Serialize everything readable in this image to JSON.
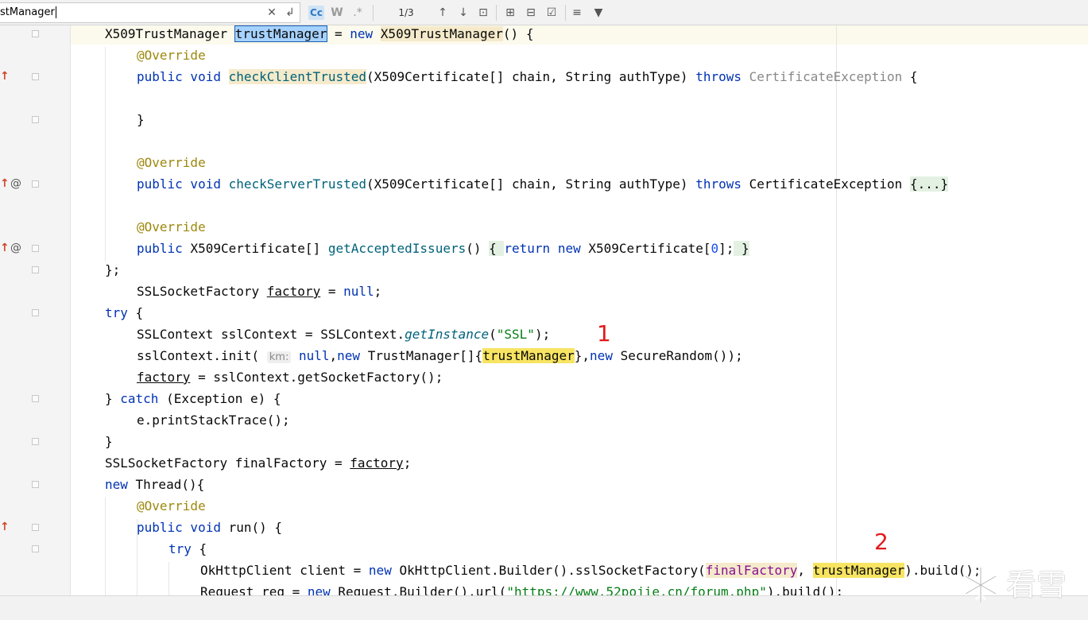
{
  "find_bar": {
    "search_value": "stManager",
    "match_case_label": "Cc",
    "words_label": "W",
    "regex_label": ".*",
    "match_count": "1/3",
    "icons": [
      "clear-icon",
      "history-icon",
      "prev-occurrence-icon",
      "next-occurrence-icon",
      "select-all-icon",
      "add-selection-icon",
      "remove-selection-icon",
      "toggle-selection-icon",
      "multiline-icon",
      "filter-icon"
    ]
  },
  "code": {
    "l1": {
      "type": "X509TrustManager ",
      "var": "trustManager",
      "eq": " = ",
      "new": "new ",
      "cls": "X509TrustManager",
      "rest": "() {"
    },
    "l2": {
      "ann": "@Override"
    },
    "l3": {
      "kw": "public void ",
      "mth": "checkClientTrusted",
      "args": "(X509Certificate[] chain, String authType) ",
      "throws": "throws ",
      "exc": "CertificateException",
      "tail": " {"
    },
    "l5": {
      "brace": "}"
    },
    "l7": {
      "ann": "@Override"
    },
    "l8": {
      "kw": "public void ",
      "mth": "checkServerTrusted",
      "args": "(X509Certificate[] chain, String authType) ",
      "throws": "throws ",
      "exc": "CertificateException ",
      "fold": "{...}"
    },
    "l10": {
      "ann": "@Override"
    },
    "l11": {
      "kw": "public ",
      "type": "X509Certificate[] ",
      "mth": "getAcceptedIssuers",
      "paren": "() ",
      "fold1": "{ ",
      "ret": "return ",
      "new": "new ",
      "cls": "X509Certificate[",
      "num": "0",
      "close": "];",
      "fold2": " }"
    },
    "l12": {
      "text": "};"
    },
    "l13": {
      "type": "SSLSocketFactory ",
      "var": "factory",
      "eq": " = ",
      "null": "null",
      ";": ";"
    },
    "l14": {
      "kw": "try",
      "rest": " {"
    },
    "l15": {
      "a": "SSLContext sslContext = SSLContext.",
      "m": "getInstance",
      "b": "(",
      "s": "\"SSL\"",
      "c": ");"
    },
    "l16": {
      "a": "sslContext.init( ",
      "hint": "km:",
      "null": " null",
      ",": ",",
      "new": "new ",
      "b": "TrustManager[]{",
      "var": "trustManager",
      "c": "},",
      "new2": "new ",
      "d": "SecureRandom());"
    },
    "l17": {
      "var": "factory",
      "rest": " = sslContext.getSocketFactory();"
    },
    "l18": {
      "a": "} ",
      "kw": "catch",
      "b": " (Exception e) {"
    },
    "l19": {
      "text": "e.printStackTrace();"
    },
    "l20": {
      "text": "}"
    },
    "l21": {
      "a": "SSLSocketFactory finalFactory = ",
      "var": "factory",
      "b": ";"
    },
    "l22": {
      "kw": "new ",
      "rest": "Thread(){"
    },
    "l23": {
      "ann": "@Override"
    },
    "l24": {
      "kw": "public void ",
      "rest": "run() {"
    },
    "l25": {
      "kw": "try",
      "rest": " {"
    },
    "l26": {
      "a": "OkHttpClient client = ",
      "new": "new ",
      "b": "OkHttpClient.Builder().sslSocketFactory(",
      "ff": "finalFactory",
      ",": ", ",
      "tm": "trustManager",
      "c": ").build();"
    },
    "l27": {
      "a": "Request req = ",
      "new": "new ",
      "b": "Request.Builder().url(",
      "s": "\"https://www.52pojie.cn/forum.php\"",
      "c": ").build();"
    }
  },
  "annotations": {
    "marker1": "1",
    "marker2": "2"
  },
  "watermark": {
    "text": "看雪"
  },
  "colors": {
    "keyword": "#0033b3",
    "annotation": "#9e880d",
    "string": "#067d17",
    "method": "#00627a",
    "number": "#1750eb",
    "marker": "#e11b1b",
    "usage_highlight": "#f7e462",
    "selection_highlight": "#a6d2ff"
  }
}
